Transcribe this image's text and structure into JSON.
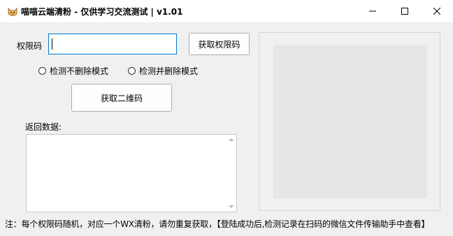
{
  "window": {
    "title": "喵喵云端清粉 - 仅供学习交流测试 | v1.01",
    "icon": "cat-icon",
    "controls": [
      "minimize-icon",
      "maximize-icon",
      "close-icon"
    ]
  },
  "form": {
    "permission_label": "权限码",
    "permission_value": "",
    "get_permission_button": "获取权限码",
    "radio_options": [
      {
        "label": "检测不删除模式",
        "checked": false
      },
      {
        "label": "检测并删除模式",
        "checked": false
      }
    ],
    "get_qr_button": "获取二维码",
    "return_label": "返回数据:",
    "return_value": ""
  },
  "footer": {
    "note": "注：每个权限码随机，对应一个WX清粉，请勿重复获取，【登陆成功后,检测记录在扫码的微信文件传输助手中查看】"
  },
  "colors": {
    "accent": "#0078d7",
    "window_bg": "#f0f0f0",
    "titlebar_bg": "#ffffff",
    "qr_placeholder": "#e6e6e6"
  }
}
